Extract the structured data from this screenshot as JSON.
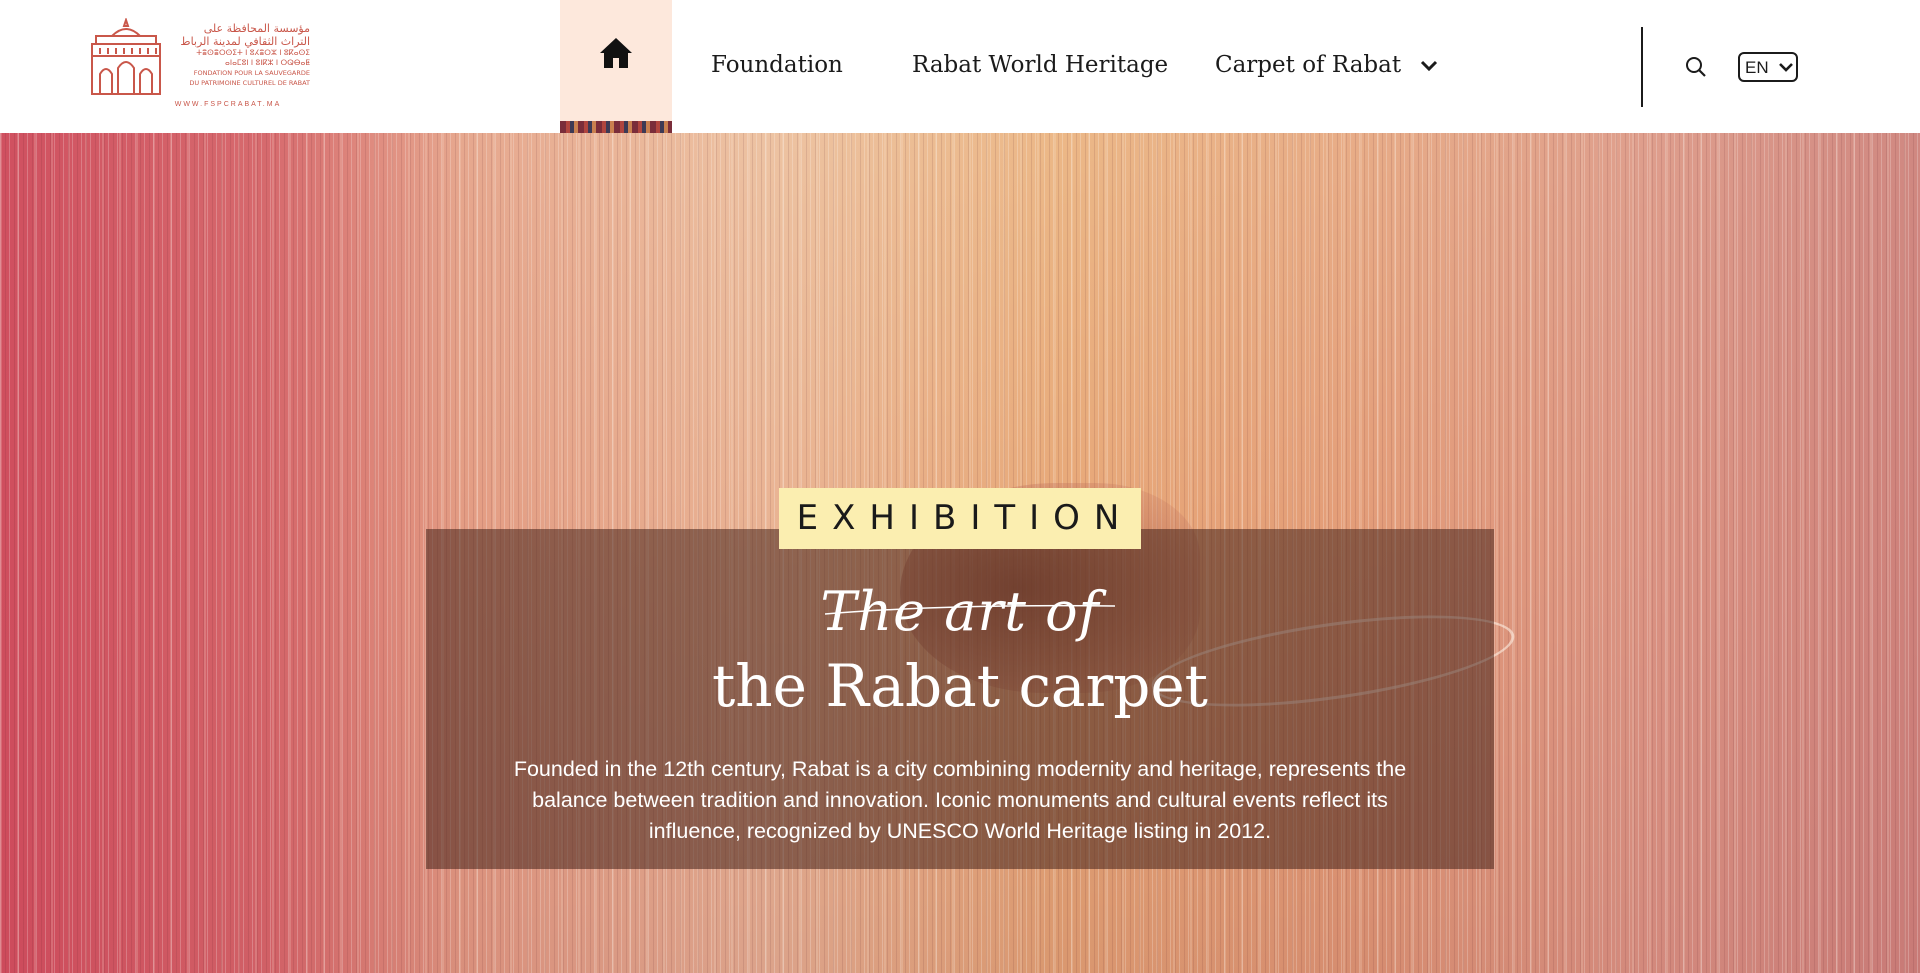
{
  "logo": {
    "arabic_line_1": "مؤسسة المحافظة على",
    "arabic_line_2": "التراث الثقافي لمدينة الرباط",
    "tifinagh_line_1": "ⵜⴻⵙⴻⵔⵙⵉⵜ ⵏ ⵓⵃⴻⵔⵣ ⵏ ⵓⴽⴰⵙⵉ",
    "tifinagh_line_2": "ⴰⵏⴰⵎⵓⵏ ⵏ ⵓⵏⴽⵣ ⵏ ⵔⵕⴱⴰⵟ",
    "french_line_1": "FONDATION POUR LA SAUVEGARDE",
    "french_line_2": "DU PATRIMOINE CULTUREL DE RABAT",
    "url": "WWW.FSPCRABAT.MA",
    "icon": "palace-gate-icon",
    "color": "#c9574a"
  },
  "nav": {
    "home_icon": "home-icon",
    "items": [
      {
        "label": "Foundation"
      },
      {
        "label": "Rabat World Heritage"
      },
      {
        "label": "Carpet of Rabat",
        "icon": "chevron-down-icon"
      }
    ],
    "active_bg": "#fde8dc"
  },
  "utilities": {
    "search_icon": "search-icon",
    "language": "EN",
    "language_icon": "chevron-down-icon"
  },
  "hero": {
    "badge": "EXHIBITION",
    "badge_color": "#fbeeb0",
    "script_title": "The art of",
    "title": "the Rabat carpet",
    "description": "Founded in the 12th century, Rabat is a city combining modernity and heritage, represents the balance between tradition and innovation. Iconic monuments and cultural events reflect its influence, recognized by UNESCO World Heritage listing in 2012."
  }
}
